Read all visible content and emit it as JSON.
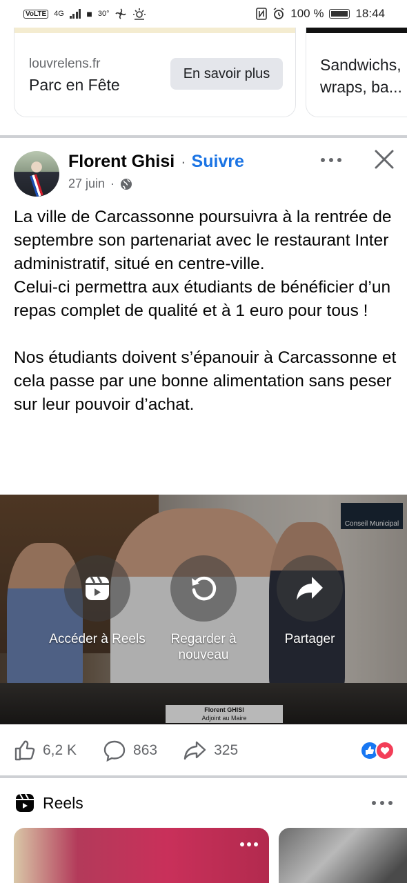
{
  "status_bar": {
    "network": "VoLTE",
    "signal_type": "4G",
    "temperature": "30°",
    "battery": "100 %",
    "time": "18:44"
  },
  "ads": [
    {
      "domain": "louvrelens.fr",
      "title": "Parc en Fête",
      "cta": "En savoir plus"
    },
    {
      "title": "Sandwichs, wraps, ba..."
    }
  ],
  "post": {
    "author": "Florent Ghisi",
    "separator": "·",
    "follow_label": "Suivre",
    "date": "27 juin",
    "meta_separator": "·",
    "text": "La ville de Carcassonne poursuivra à la rentrée de septembre son partenariat avec le restaurant Inter administratif, situé en centre-ville.\nCelui-ci permettra aux étudiants de bénéficier d’un repas complet de qualité et à 1 euro pour tous !\n\nNos étudiants doivent s’épanouir à Carcassonne et cela passe par une bonne alimentation sans peser sur leur pouvoir d’achat.",
    "video": {
      "badge_text": "Conseil Municipal",
      "nameplate_name": "Florent GHISI",
      "nameplate_role": "Adjoint au Maire",
      "actions": [
        {
          "label": "Accéder à Reels",
          "icon": "reels-icon"
        },
        {
          "label": "Regarder à nouveau",
          "icon": "replay-icon"
        },
        {
          "label": "Partager",
          "icon": "share-arrow-icon"
        }
      ]
    },
    "reactions": {
      "likes": "6,2 K",
      "comments": "863",
      "shares": "325",
      "emoji_types": [
        "like",
        "love"
      ]
    }
  },
  "reels_section": {
    "title": "Reels"
  },
  "colors": {
    "accent_blue": "#1b74e4",
    "like_blue": "#1877f2",
    "love_red": "#f33e58",
    "secondary_text": "#65676b"
  }
}
